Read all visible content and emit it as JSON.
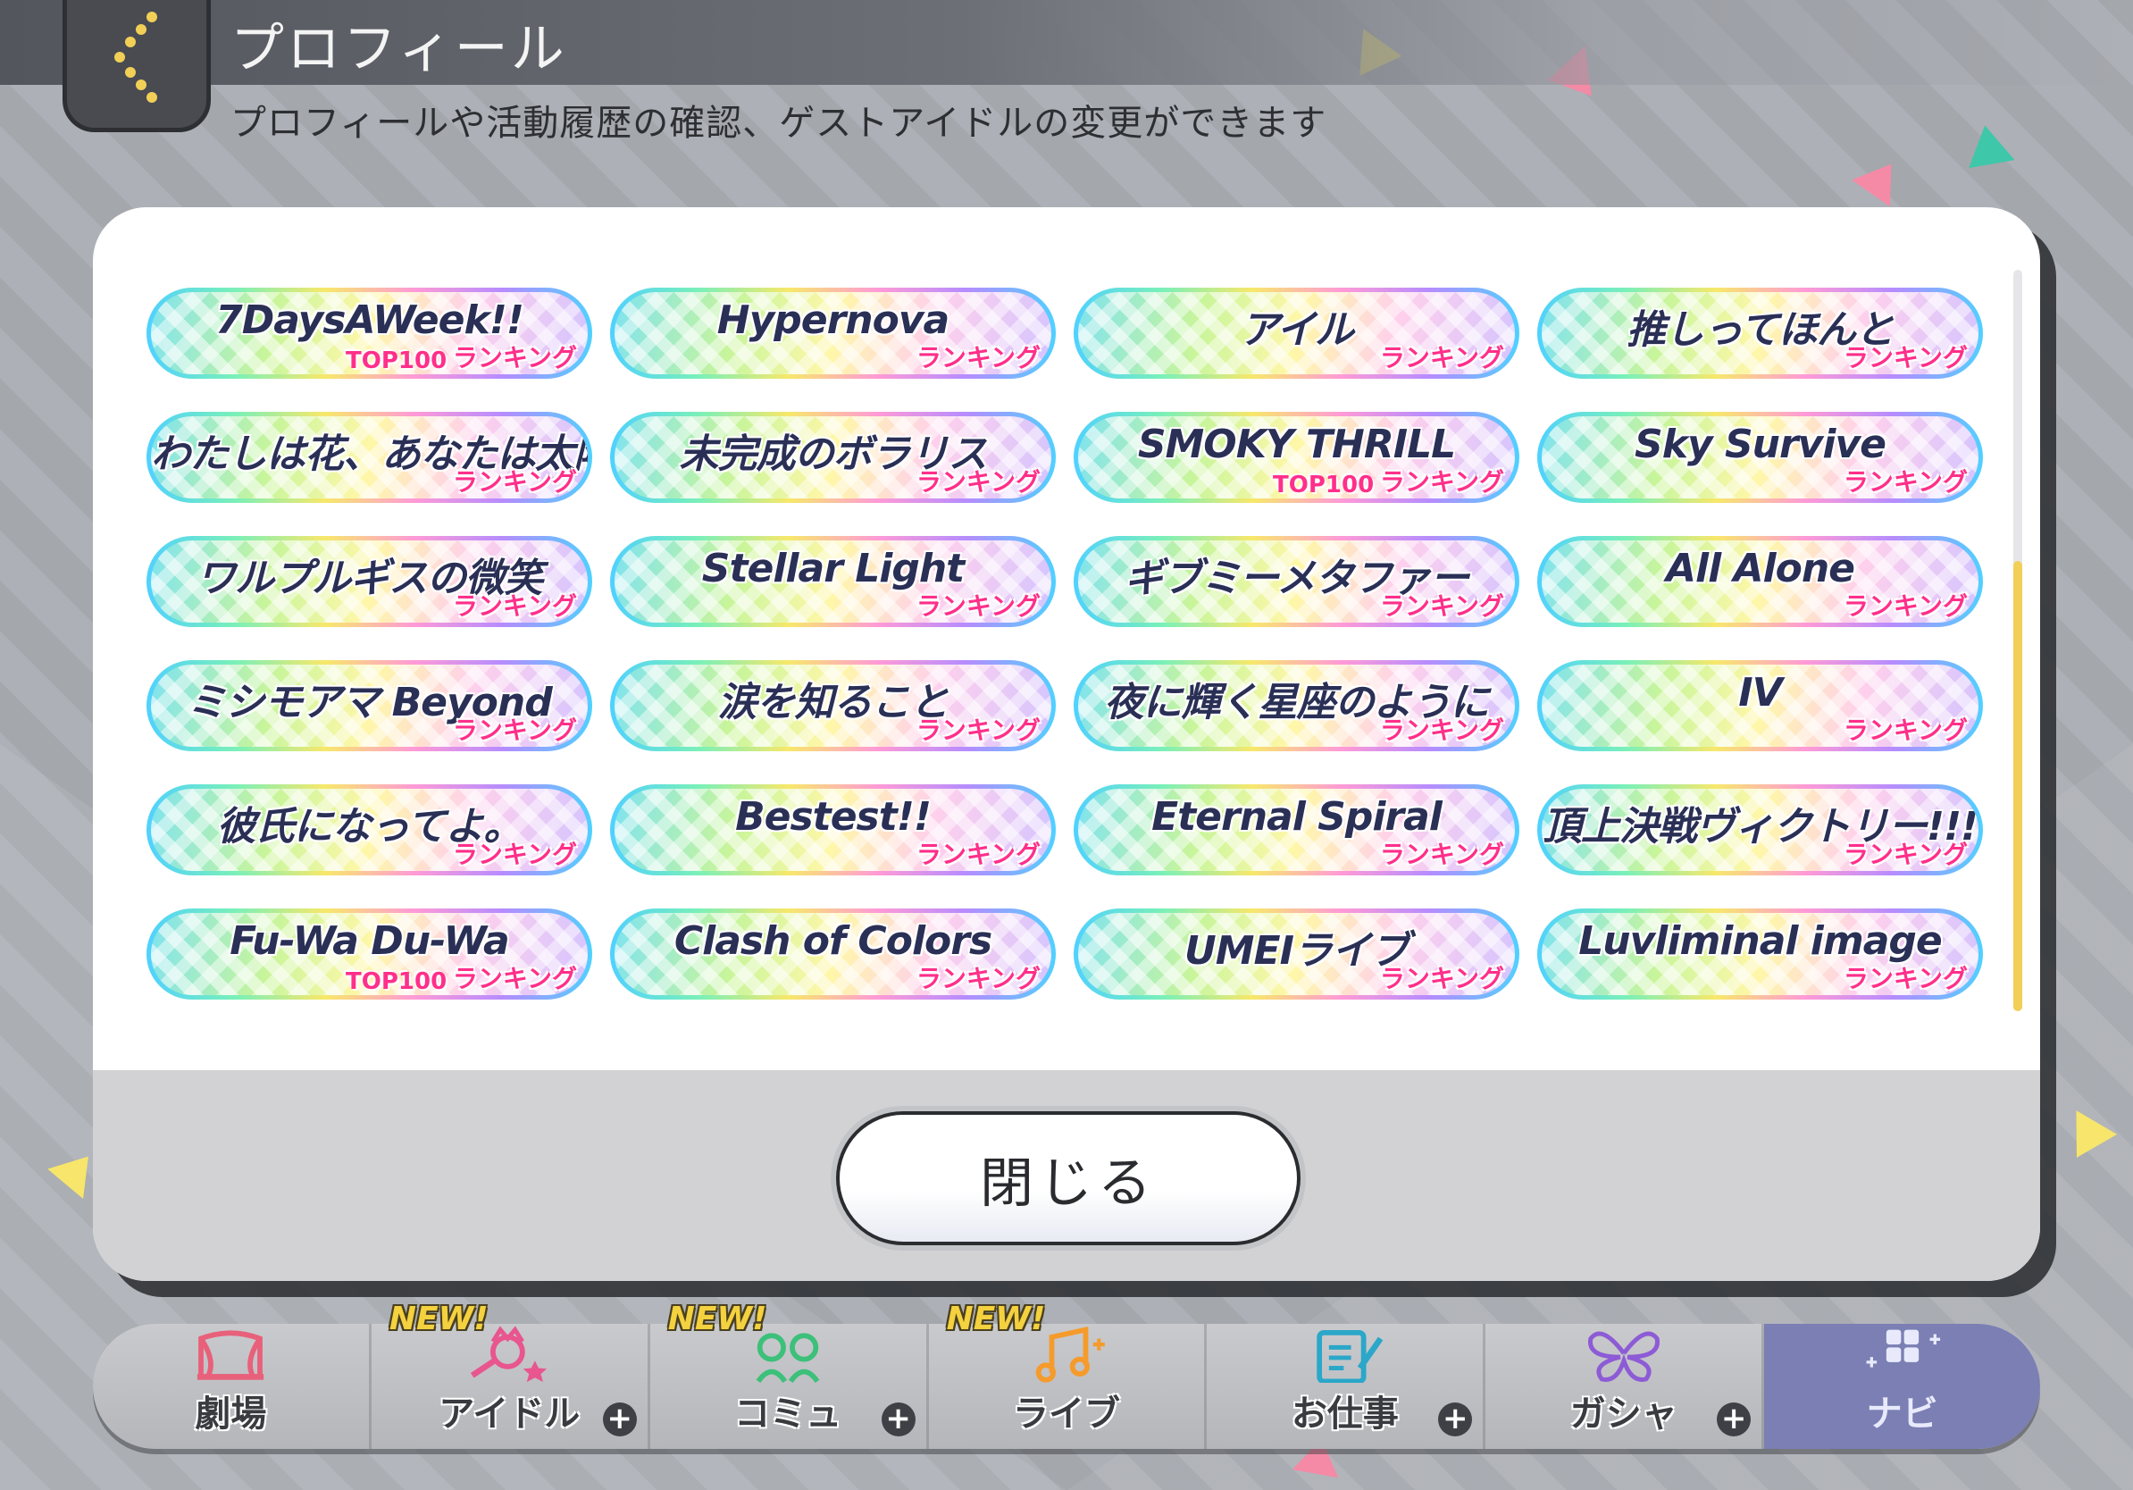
{
  "header": {
    "title": "プロフィール",
    "subtitle": "プロフィールや活動履歴の確認、ゲストアイドルの変更ができます"
  },
  "modal": {
    "close_label": "閉じる",
    "badges": [
      {
        "title": "7DaysAWeek!!",
        "rank": "ランキング",
        "top": "TOP100"
      },
      {
        "title": "Hypernova",
        "rank": "ランキング",
        "top": ""
      },
      {
        "title": "アイル",
        "rank": "ランキング",
        "top": ""
      },
      {
        "title": "推しってほんと",
        "rank": "ランキング",
        "top": ""
      },
      {
        "title": "わたしは花、あなたは太陽",
        "rank": "ランキング",
        "top": ""
      },
      {
        "title": "未完成のボラリス",
        "rank": "ランキング",
        "top": ""
      },
      {
        "title": "SMOKY THRILL",
        "rank": "ランキング",
        "top": "TOP100"
      },
      {
        "title": "Sky Survive",
        "rank": "ランキング",
        "top": ""
      },
      {
        "title": "ワルプルギスの微笑",
        "rank": "ランキング",
        "top": ""
      },
      {
        "title": "Stellar Light",
        "rank": "ランキング",
        "top": ""
      },
      {
        "title": "ギブミーメタファー",
        "rank": "ランキング",
        "top": ""
      },
      {
        "title": "All Alone",
        "rank": "ランキング",
        "top": ""
      },
      {
        "title": "ミシモアマ Beyond",
        "rank": "ランキング",
        "top": ""
      },
      {
        "title": "涙を知ること",
        "rank": "ランキング",
        "top": ""
      },
      {
        "title": "夜に輝く星座のように",
        "rank": "ランキング",
        "top": ""
      },
      {
        "title": "IV",
        "rank": "ランキング",
        "top": ""
      },
      {
        "title": "彼氏になってよ。",
        "rank": "ランキング",
        "top": ""
      },
      {
        "title": "Bestest!!",
        "rank": "ランキング",
        "top": ""
      },
      {
        "title": "Eternal Spiral",
        "rank": "ランキング",
        "top": ""
      },
      {
        "title": "頂上決戦ヴィクトリー!!!",
        "rank": "ランキング",
        "top": ""
      },
      {
        "title": "Fu-Wa Du-Wa",
        "rank": "ランキング",
        "top": "TOP100"
      },
      {
        "title": "Clash of Colors",
        "rank": "ランキング",
        "top": ""
      },
      {
        "title": "UMEIライブ",
        "rank": "ランキング",
        "top": ""
      },
      {
        "title": "Luvliminal image",
        "rank": "ランキング",
        "top": ""
      }
    ]
  },
  "nav": {
    "items": [
      {
        "label": "劇場",
        "icon": "theater-icon",
        "new": "",
        "plus": false
      },
      {
        "label": "アイドル",
        "icon": "idol-icon",
        "new": "NEW!",
        "plus": true
      },
      {
        "label": "コミュ",
        "icon": "commu-icon",
        "new": "NEW!",
        "plus": true
      },
      {
        "label": "ライブ",
        "icon": "live-icon",
        "new": "NEW!",
        "plus": false
      },
      {
        "label": "お仕事",
        "icon": "work-icon",
        "new": "",
        "plus": true
      },
      {
        "label": "ガシャ",
        "icon": "gacha-icon",
        "new": "",
        "plus": true
      },
      {
        "label": "ナビ",
        "icon": "navi-icon",
        "new": "",
        "plus": false
      }
    ]
  },
  "colors": {
    "ranking_pink": "#ff2f8a",
    "scroll_thumb": "#f2cf57",
    "navi_active": "#7b7fb3"
  }
}
